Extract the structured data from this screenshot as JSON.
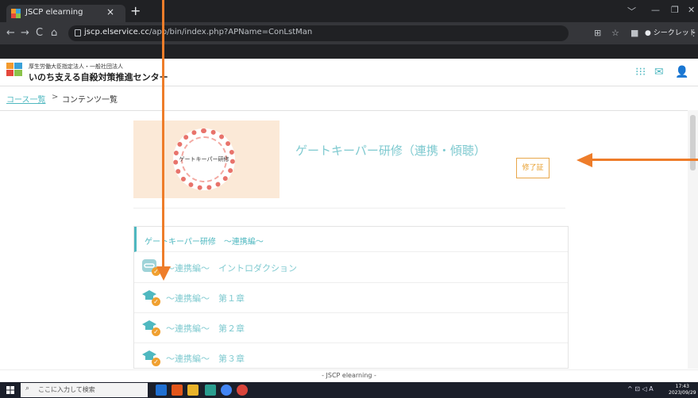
{
  "browser": {
    "tab_title": "JSCP elearning",
    "tab_close": "×",
    "new_tab": "+",
    "url_host": "jscp.elservice.cc",
    "url_path": "/app/bin/index.php?APName=ConLstMan",
    "incognito_label": "シークレット",
    "win_controls": [
      "﹀",
      "—",
      "❐",
      "✕"
    ]
  },
  "site": {
    "org_subtitle": "厚生労働大臣指定法人・一般社団法人",
    "org_name": "いのち支える自殺対策推進センター"
  },
  "breadcrumb": {
    "home": "コース一覧",
    "separator": ">",
    "current": "コンテンツ一覧"
  },
  "course": {
    "thumb_label": "ゲートキーパー研修",
    "title": "ゲートキーパー研修（連携・傾聴）",
    "cert_button": "修了証"
  },
  "section": {
    "title": "ゲートキーパー研修　～連携編～",
    "items": [
      {
        "label": "～連携編～　イントロダクション",
        "icon": "link-icon"
      },
      {
        "label": "～連携編～　第１章",
        "icon": "graduation-cap-icon"
      },
      {
        "label": "～連携編～　第２章",
        "icon": "graduation-cap-icon"
      },
      {
        "label": "～連携編～　第３章",
        "icon": "graduation-cap-icon"
      }
    ]
  },
  "footer": {
    "text": "- JSCP elearning -"
  },
  "taskbar": {
    "search_placeholder": "ここに入力して検索",
    "clock_time": "17:43",
    "clock_date": "2023/09/29",
    "tray_text": "^ ⊡ ◁ A"
  },
  "colors": {
    "accent_teal": "#4fb8c0",
    "link_teal": "#7fcad0",
    "orange": "#ee7d2a",
    "cert_orange": "#e89f2e"
  }
}
